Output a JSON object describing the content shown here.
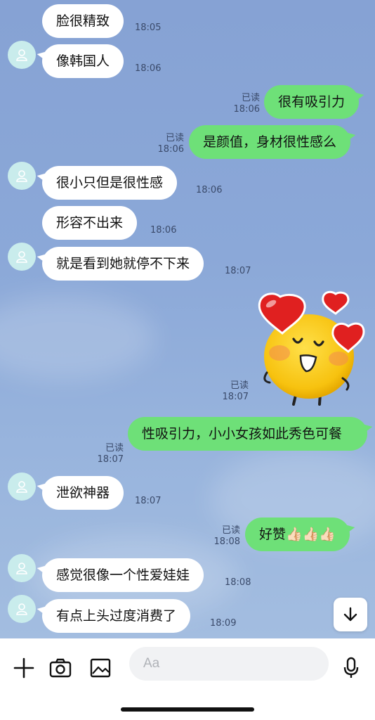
{
  "messages": [
    {
      "dir": "in",
      "avatar": false,
      "text": "脸很精致",
      "time": "18:05"
    },
    {
      "dir": "in",
      "avatar": true,
      "text": "像韩国人",
      "time": "18:06"
    },
    {
      "dir": "out",
      "text": "很有吸引力",
      "read": "已读",
      "time": "18:06"
    },
    {
      "dir": "out",
      "text": "是颜值，身材很性感么",
      "read": "已读",
      "time": "18:06"
    },
    {
      "dir": "in",
      "avatar": true,
      "text": "很小只但是很性感",
      "time": "18:06"
    },
    {
      "dir": "in",
      "avatar": false,
      "text": "形容不出来",
      "time": "18:06"
    },
    {
      "dir": "in",
      "avatar": true,
      "text": "就是看到她就停不下来",
      "time": "18:07"
    },
    {
      "dir": "out",
      "sticker": "heart-face-sticker",
      "read": "已读",
      "time": "18:07"
    },
    {
      "dir": "out",
      "text": "性吸引力，小小女孩如此秀色可餐",
      "read": "已读",
      "time": "18:07"
    },
    {
      "dir": "in",
      "avatar": true,
      "text": "泄欲神器",
      "time": "18:07"
    },
    {
      "dir": "out",
      "text": "好赞👍🏻👍🏻👍🏻",
      "read": "已读",
      "time": "18:08"
    },
    {
      "dir": "in",
      "avatar": true,
      "text": "感觉很像一个性爱娃娃",
      "time": "18:08"
    },
    {
      "dir": "in",
      "avatar": true,
      "text": "有点上头过度消费了",
      "time": "18:09"
    }
  ],
  "input": {
    "placeholder": "Aa"
  },
  "icons": {
    "add": "plus-icon",
    "camera": "camera-icon",
    "image": "image-icon",
    "emoji": "smiley-icon",
    "mic": "microphone-icon",
    "scroll": "arrow-down-icon",
    "avatar": "default-user-icon"
  },
  "colors": {
    "chat_bg": "#8aa6d6",
    "out_bubble": "#6ee078",
    "in_bubble": "#ffffff",
    "avatar_bg": "#c9ecec"
  }
}
